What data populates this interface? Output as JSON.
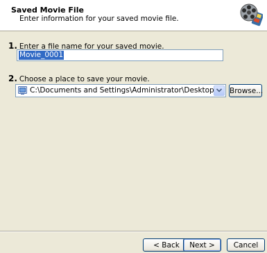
{
  "header": {
    "title": "Saved Movie File",
    "subtitle": "Enter information for your saved movie file.",
    "icon": "film-reel-icon"
  },
  "step1": {
    "number": "1.",
    "label": "Enter a file name for your saved movie.",
    "filename_value": "Movie_0001"
  },
  "step2": {
    "number": "2.",
    "label": "Choose a place to save your movie.",
    "location_value": "C:\\Documents and Settings\\Administrator\\Desktop",
    "browse_label": "Browse..."
  },
  "footer": {
    "back_label": "< Back",
    "next_label": "Next >",
    "cancel_label": "Cancel"
  },
  "colors": {
    "dialog_bg": "#ece9d8",
    "selection": "#316ac5",
    "field_border": "#7f9db9"
  }
}
